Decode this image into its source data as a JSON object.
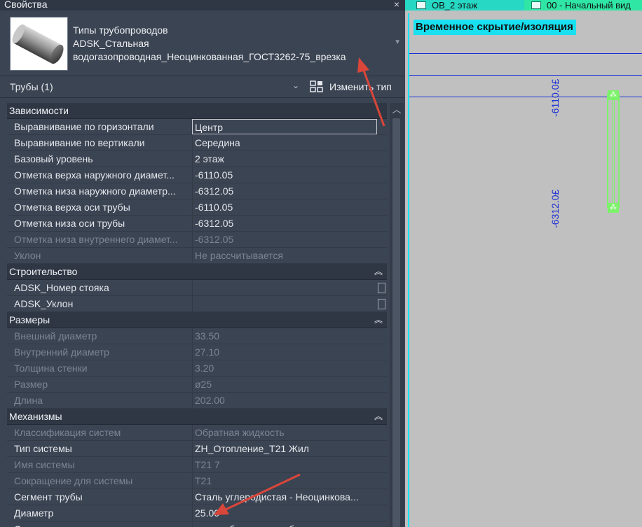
{
  "panel": {
    "title": "Свойства",
    "close_glyph": "×",
    "type_lines": [
      "Типы трубопроводов",
      "ADSK_Стальная",
      "водогазопроводная_Неоцинкованная_ГОСТ3262-75_врезка"
    ],
    "filter_label": "Трубы (1)",
    "edit_type_label": "Изменить тип"
  },
  "sections": [
    {
      "name": "Зависимости",
      "rows": [
        {
          "key": "Выравнивание по горизонтали",
          "value": "Центр",
          "dim": false,
          "editing": true
        },
        {
          "key": "Выравнивание по вертикали",
          "value": "Середина",
          "dim": false
        },
        {
          "key": "Базовый уровень",
          "value": "2 этаж",
          "dim": false
        },
        {
          "key": "Отметка верха наружного диамет...",
          "value": "-6110.05",
          "dim": false
        },
        {
          "key": "Отметка низа наружного диаметр...",
          "value": "-6312.05",
          "dim": false
        },
        {
          "key": "Отметка верха оси трубы",
          "value": "-6110.05",
          "dim": false
        },
        {
          "key": "Отметка низа оси трубы",
          "value": "-6312.05",
          "dim": false
        },
        {
          "key": "Отметка низа внутреннего диамет...",
          "value": "-6312.05",
          "dim": true
        },
        {
          "key": "Уклон",
          "value": "Не рассчитывается",
          "dim": true
        }
      ]
    },
    {
      "name": "Строительство",
      "rows": [
        {
          "key": "ADSK_Номер стояка",
          "value": "",
          "dim": false,
          "checkbox": true
        },
        {
          "key": "ADSK_Уклон",
          "value": "",
          "dim": false,
          "checkbox": true
        }
      ]
    },
    {
      "name": "Размеры",
      "rows": [
        {
          "key": "Внешний диаметр",
          "value": "33.50",
          "dim": true
        },
        {
          "key": "Внутренний диаметр",
          "value": "27.10",
          "dim": true
        },
        {
          "key": "Толщина стенки",
          "value": "3.20",
          "dim": true
        },
        {
          "key": "Размер",
          "value": "ø25",
          "dim": true
        },
        {
          "key": "Длина",
          "value": "202.00",
          "dim": true
        }
      ]
    },
    {
      "name": "Механизмы",
      "rows": [
        {
          "key": "Классификация систем",
          "value": "Обратная жидкость",
          "dim": true
        },
        {
          "key": "Тип системы",
          "value": "ZH_Отопление_Т21 Жил",
          "dim": false
        },
        {
          "key": "Имя системы",
          "value": "Т21 7",
          "dim": true
        },
        {
          "key": "Сокращение для системы",
          "value": "Т21",
          "dim": true
        },
        {
          "key": "Сегмент трубы",
          "value": "Сталь углеродистая - Неоцинкова...",
          "dim": false
        },
        {
          "key": "Диаметр",
          "value": "25.00",
          "dim": false
        },
        {
          "key": "Описание сегмента",
          "value": "для труб стальных обыкновенных с...",
          "dim": false
        }
      ]
    }
  ],
  "view": {
    "tab1": "ОВ_2 этаж",
    "tab2": "00 - Начальный вид",
    "title": "Временное скрытие/изоляция",
    "label_top": "-6110.0£",
    "label_bottom": "-6312.0£"
  },
  "colors": {
    "annotation_arrow": "#d9463a",
    "view_border": "#00e5ff",
    "selection": "#7cf26a"
  }
}
